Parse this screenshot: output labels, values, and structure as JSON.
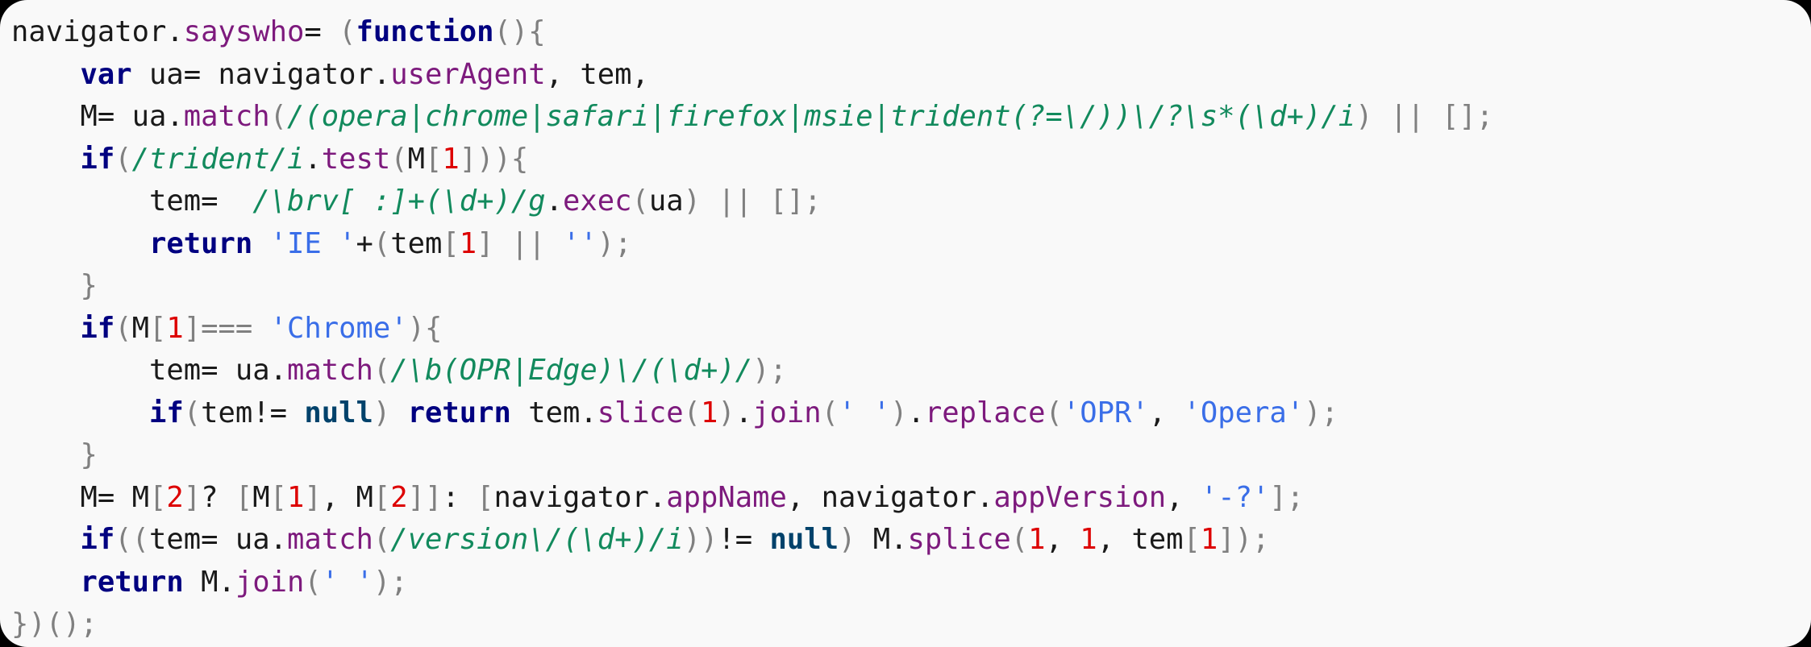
{
  "card": {
    "background": "#f9f9f9",
    "outer_background": "#000000",
    "corner_radius_px": 34
  },
  "theme": {
    "plain": "#1a1a1a",
    "keyword": "#000080",
    "null_literal": "#00426b",
    "property": "#7d1a7d",
    "regex": "#128a5d",
    "string": "#3a6ee8",
    "number": "#dd0000",
    "punctuation": "#808080",
    "operator": "#555555"
  },
  "code": {
    "language": "javascript",
    "plain_text": "navigator.sayswho= (function(){\n    var ua= navigator.userAgent, tem,\n    M= ua.match(/(opera|chrome|safari|firefox|msie|trident(?=\\/))\\/?\\s*(\\d+)/i) || [];\n    if(/trident/i.test(M[1])){\n        tem=  /\\brv[ :]+(\\d+)/g.exec(ua) || [];\n        return 'IE '+(tem[1] || '');\n    }\n    if(M[1]=== 'Chrome'){\n        tem= ua.match(/\\b(OPR|Edge)\\/(\\d+)/);\n        if(tem!= null) return tem.slice(1).join(' ').replace('OPR', 'Opera');\n    }\n    M= M[2]? [M[1], M[2]]: [navigator.appName, navigator.appVersion, '-?'];\n    if((tem= ua.match(/version\\/(\\d+)/i))!= null) M.splice(1, 1, tem[1]);\n    return M.join(' ');\n})();",
    "lines": [
      {
        "index": 1,
        "tokens": [
          {
            "text": "navigator",
            "type": "plain"
          },
          {
            "text": ".",
            "type": "plain"
          },
          {
            "text": "sayswho",
            "type": "property"
          },
          {
            "text": "=",
            "type": "plain"
          },
          {
            "text": " ",
            "type": "plain"
          },
          {
            "text": "(",
            "type": "punctuation"
          },
          {
            "text": "function",
            "type": "keyword"
          },
          {
            "text": "()",
            "type": "punctuation"
          },
          {
            "text": "{",
            "type": "punctuation"
          }
        ]
      },
      {
        "index": 2,
        "tokens": [
          {
            "text": "    ",
            "type": "plain"
          },
          {
            "text": "var",
            "type": "keyword"
          },
          {
            "text": " ua",
            "type": "plain"
          },
          {
            "text": "=",
            "type": "plain"
          },
          {
            "text": " navigator.",
            "type": "plain"
          },
          {
            "text": "userAgent",
            "type": "property"
          },
          {
            "text": ", tem,",
            "type": "plain"
          }
        ]
      },
      {
        "index": 3,
        "tokens": [
          {
            "text": "    M",
            "type": "plain"
          },
          {
            "text": "=",
            "type": "plain"
          },
          {
            "text": " ua.",
            "type": "plain"
          },
          {
            "text": "match",
            "type": "property"
          },
          {
            "text": "(",
            "type": "punctuation"
          },
          {
            "text": "/(opera|chrome|safari|firefox|msie|trident(?=\\/))\\/?\\s*(\\d+)/i",
            "type": "regex"
          },
          {
            "text": ")",
            "type": "punctuation"
          },
          {
            "text": " ",
            "type": "plain"
          },
          {
            "text": "||",
            "type": "punctuation"
          },
          {
            "text": " ",
            "type": "plain"
          },
          {
            "text": "[];",
            "type": "punctuation"
          }
        ]
      },
      {
        "index": 4,
        "tokens": [
          {
            "text": "    ",
            "type": "plain"
          },
          {
            "text": "if",
            "type": "keyword"
          },
          {
            "text": "(",
            "type": "punctuation"
          },
          {
            "text": "/trident/i",
            "type": "regex"
          },
          {
            "text": ".",
            "type": "plain"
          },
          {
            "text": "test",
            "type": "property"
          },
          {
            "text": "(",
            "type": "punctuation"
          },
          {
            "text": "M",
            "type": "plain"
          },
          {
            "text": "[",
            "type": "punctuation"
          },
          {
            "text": "1",
            "type": "number"
          },
          {
            "text": "]))",
            "type": "punctuation"
          },
          {
            "text": "{",
            "type": "punctuation"
          }
        ]
      },
      {
        "index": 5,
        "tokens": [
          {
            "text": "        tem",
            "type": "plain"
          },
          {
            "text": "=",
            "type": "plain"
          },
          {
            "text": "  ",
            "type": "plain"
          },
          {
            "text": "/\\brv[ :]+(\\d+)/g",
            "type": "regex"
          },
          {
            "text": ".",
            "type": "plain"
          },
          {
            "text": "exec",
            "type": "property"
          },
          {
            "text": "(",
            "type": "punctuation"
          },
          {
            "text": "ua",
            "type": "plain"
          },
          {
            "text": ")",
            "type": "punctuation"
          },
          {
            "text": " ",
            "type": "plain"
          },
          {
            "text": "||",
            "type": "punctuation"
          },
          {
            "text": " ",
            "type": "plain"
          },
          {
            "text": "[];",
            "type": "punctuation"
          }
        ]
      },
      {
        "index": 6,
        "tokens": [
          {
            "text": "        ",
            "type": "plain"
          },
          {
            "text": "return",
            "type": "keyword"
          },
          {
            "text": " ",
            "type": "plain"
          },
          {
            "text": "'IE '",
            "type": "string"
          },
          {
            "text": "+",
            "type": "plain"
          },
          {
            "text": "(",
            "type": "punctuation"
          },
          {
            "text": "tem",
            "type": "plain"
          },
          {
            "text": "[",
            "type": "punctuation"
          },
          {
            "text": "1",
            "type": "number"
          },
          {
            "text": "]",
            "type": "punctuation"
          },
          {
            "text": " ",
            "type": "plain"
          },
          {
            "text": "||",
            "type": "punctuation"
          },
          {
            "text": " ",
            "type": "plain"
          },
          {
            "text": "''",
            "type": "string"
          },
          {
            "text": ");",
            "type": "punctuation"
          }
        ]
      },
      {
        "index": 7,
        "tokens": [
          {
            "text": "    ",
            "type": "plain"
          },
          {
            "text": "}",
            "type": "punctuation"
          }
        ]
      },
      {
        "index": 8,
        "tokens": [
          {
            "text": "    ",
            "type": "plain"
          },
          {
            "text": "if",
            "type": "keyword"
          },
          {
            "text": "(",
            "type": "punctuation"
          },
          {
            "text": "M",
            "type": "plain"
          },
          {
            "text": "[",
            "type": "punctuation"
          },
          {
            "text": "1",
            "type": "number"
          },
          {
            "text": "]",
            "type": "punctuation"
          },
          {
            "text": "===",
            "type": "punctuation"
          },
          {
            "text": " ",
            "type": "plain"
          },
          {
            "text": "'Chrome'",
            "type": "string"
          },
          {
            "text": ")",
            "type": "punctuation"
          },
          {
            "text": "{",
            "type": "punctuation"
          }
        ]
      },
      {
        "index": 9,
        "tokens": [
          {
            "text": "        tem",
            "type": "plain"
          },
          {
            "text": "=",
            "type": "plain"
          },
          {
            "text": " ua.",
            "type": "plain"
          },
          {
            "text": "match",
            "type": "property"
          },
          {
            "text": "(",
            "type": "punctuation"
          },
          {
            "text": "/\\b(OPR|Edge)\\/(\\d+)/",
            "type": "regex"
          },
          {
            "text": ");",
            "type": "punctuation"
          }
        ]
      },
      {
        "index": 10,
        "tokens": [
          {
            "text": "        ",
            "type": "plain"
          },
          {
            "text": "if",
            "type": "keyword"
          },
          {
            "text": "(",
            "type": "punctuation"
          },
          {
            "text": "tem",
            "type": "plain"
          },
          {
            "text": "!=",
            "type": "plain"
          },
          {
            "text": " ",
            "type": "plain"
          },
          {
            "text": "null",
            "type": "null_literal"
          },
          {
            "text": ")",
            "type": "punctuation"
          },
          {
            "text": " ",
            "type": "plain"
          },
          {
            "text": "return",
            "type": "keyword"
          },
          {
            "text": " tem.",
            "type": "plain"
          },
          {
            "text": "slice",
            "type": "property"
          },
          {
            "text": "(",
            "type": "punctuation"
          },
          {
            "text": "1",
            "type": "number"
          },
          {
            "text": ")",
            "type": "punctuation"
          },
          {
            "text": ".",
            "type": "plain"
          },
          {
            "text": "join",
            "type": "property"
          },
          {
            "text": "(",
            "type": "punctuation"
          },
          {
            "text": "' '",
            "type": "string"
          },
          {
            "text": ")",
            "type": "punctuation"
          },
          {
            "text": ".",
            "type": "plain"
          },
          {
            "text": "replace",
            "type": "property"
          },
          {
            "text": "(",
            "type": "punctuation"
          },
          {
            "text": "'OPR'",
            "type": "string"
          },
          {
            "text": ", ",
            "type": "plain"
          },
          {
            "text": "'Opera'",
            "type": "string"
          },
          {
            "text": ");",
            "type": "punctuation"
          }
        ]
      },
      {
        "index": 11,
        "tokens": [
          {
            "text": "    ",
            "type": "plain"
          },
          {
            "text": "}",
            "type": "punctuation"
          }
        ]
      },
      {
        "index": 12,
        "tokens": [
          {
            "text": "    M",
            "type": "plain"
          },
          {
            "text": "=",
            "type": "plain"
          },
          {
            "text": " M",
            "type": "plain"
          },
          {
            "text": "[",
            "type": "punctuation"
          },
          {
            "text": "2",
            "type": "number"
          },
          {
            "text": "]",
            "type": "punctuation"
          },
          {
            "text": "?",
            "type": "plain"
          },
          {
            "text": " ",
            "type": "plain"
          },
          {
            "text": "[",
            "type": "punctuation"
          },
          {
            "text": "M",
            "type": "plain"
          },
          {
            "text": "[",
            "type": "punctuation"
          },
          {
            "text": "1",
            "type": "number"
          },
          {
            "text": "]",
            "type": "punctuation"
          },
          {
            "text": ", M",
            "type": "plain"
          },
          {
            "text": "[",
            "type": "punctuation"
          },
          {
            "text": "2",
            "type": "number"
          },
          {
            "text": "]]",
            "type": "punctuation"
          },
          {
            "text": ":",
            "type": "plain"
          },
          {
            "text": " ",
            "type": "plain"
          },
          {
            "text": "[",
            "type": "punctuation"
          },
          {
            "text": "navigator.",
            "type": "plain"
          },
          {
            "text": "appName",
            "type": "property"
          },
          {
            "text": ", navigator.",
            "type": "plain"
          },
          {
            "text": "appVersion",
            "type": "property"
          },
          {
            "text": ", ",
            "type": "plain"
          },
          {
            "text": "'-?'",
            "type": "string"
          },
          {
            "text": "];",
            "type": "punctuation"
          }
        ]
      },
      {
        "index": 13,
        "tokens": [
          {
            "text": "    ",
            "type": "plain"
          },
          {
            "text": "if",
            "type": "keyword"
          },
          {
            "text": "((",
            "type": "punctuation"
          },
          {
            "text": "tem",
            "type": "plain"
          },
          {
            "text": "=",
            "type": "plain"
          },
          {
            "text": " ua.",
            "type": "plain"
          },
          {
            "text": "match",
            "type": "property"
          },
          {
            "text": "(",
            "type": "punctuation"
          },
          {
            "text": "/version\\/(\\d+)/i",
            "type": "regex"
          },
          {
            "text": "))",
            "type": "punctuation"
          },
          {
            "text": "!=",
            "type": "plain"
          },
          {
            "text": " ",
            "type": "plain"
          },
          {
            "text": "null",
            "type": "null_literal"
          },
          {
            "text": ")",
            "type": "punctuation"
          },
          {
            "text": " M.",
            "type": "plain"
          },
          {
            "text": "splice",
            "type": "property"
          },
          {
            "text": "(",
            "type": "punctuation"
          },
          {
            "text": "1",
            "type": "number"
          },
          {
            "text": ", ",
            "type": "plain"
          },
          {
            "text": "1",
            "type": "number"
          },
          {
            "text": ", tem",
            "type": "plain"
          },
          {
            "text": "[",
            "type": "punctuation"
          },
          {
            "text": "1",
            "type": "number"
          },
          {
            "text": "]);",
            "type": "punctuation"
          }
        ]
      },
      {
        "index": 14,
        "tokens": [
          {
            "text": "    ",
            "type": "plain"
          },
          {
            "text": "return",
            "type": "keyword"
          },
          {
            "text": " M.",
            "type": "plain"
          },
          {
            "text": "join",
            "type": "property"
          },
          {
            "text": "(",
            "type": "punctuation"
          },
          {
            "text": "' '",
            "type": "string"
          },
          {
            "text": ");",
            "type": "punctuation"
          }
        ]
      },
      {
        "index": 15,
        "tokens": [
          {
            "text": "})();",
            "type": "punctuation"
          }
        ]
      }
    ]
  }
}
